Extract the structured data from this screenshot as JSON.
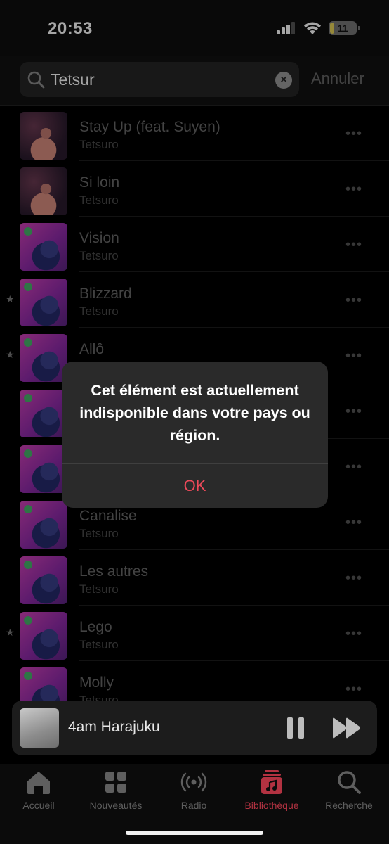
{
  "status_bar": {
    "time": "20:53",
    "battery": "11",
    "icons": [
      "cellular-signal-icon",
      "wifi-icon",
      "battery-icon"
    ]
  },
  "search": {
    "value": "Tetsur",
    "clear_icon": "×",
    "cancel_label": "Annuler"
  },
  "songs": [
    {
      "title": "Stay Up (feat. Suyen)",
      "artist": "Tetsuro",
      "starred": false,
      "art": "photo"
    },
    {
      "title": "Si loin",
      "artist": "Tetsuro",
      "starred": false,
      "art": "photo"
    },
    {
      "title": "Vision",
      "artist": "Tetsuro",
      "starred": false,
      "art": "album"
    },
    {
      "title": "Blizzard",
      "artist": "Tetsuro",
      "starred": true,
      "art": "album"
    },
    {
      "title": "Allô",
      "artist": "Tetsuro",
      "starred": true,
      "art": "album"
    },
    {
      "title": "",
      "artist": "",
      "starred": false,
      "art": "album"
    },
    {
      "title": "",
      "artist": "",
      "starred": false,
      "art": "album"
    },
    {
      "title": "Canalise",
      "artist": "Tetsuro",
      "starred": false,
      "art": "album"
    },
    {
      "title": "Les autres",
      "artist": "Tetsuro",
      "starred": false,
      "art": "album"
    },
    {
      "title": "Lego",
      "artist": "Tetsuro",
      "starred": true,
      "art": "album"
    },
    {
      "title": "Molly",
      "artist": "Tetsuro",
      "starred": false,
      "art": "album"
    }
  ],
  "more_glyph": "•••",
  "star_glyph": "★",
  "alert": {
    "message": "Cet élément est actuellement indisponible dans votre pays ou région.",
    "ok_label": "OK"
  },
  "mini_player": {
    "title": "4am Harajuku"
  },
  "tabs": [
    {
      "label": "Accueil",
      "icon": "home-icon",
      "active": false
    },
    {
      "label": "Nouveautés",
      "icon": "grid-icon",
      "active": false
    },
    {
      "label": "Radio",
      "icon": "radio-icon",
      "active": false
    },
    {
      "label": "Bibliothèque",
      "icon": "library-icon",
      "active": true
    },
    {
      "label": "Recherche",
      "icon": "search-icon",
      "active": false
    }
  ],
  "colors": {
    "accent": "#ee4a5a",
    "active_tab": "#b23241",
    "background": "#000000"
  }
}
